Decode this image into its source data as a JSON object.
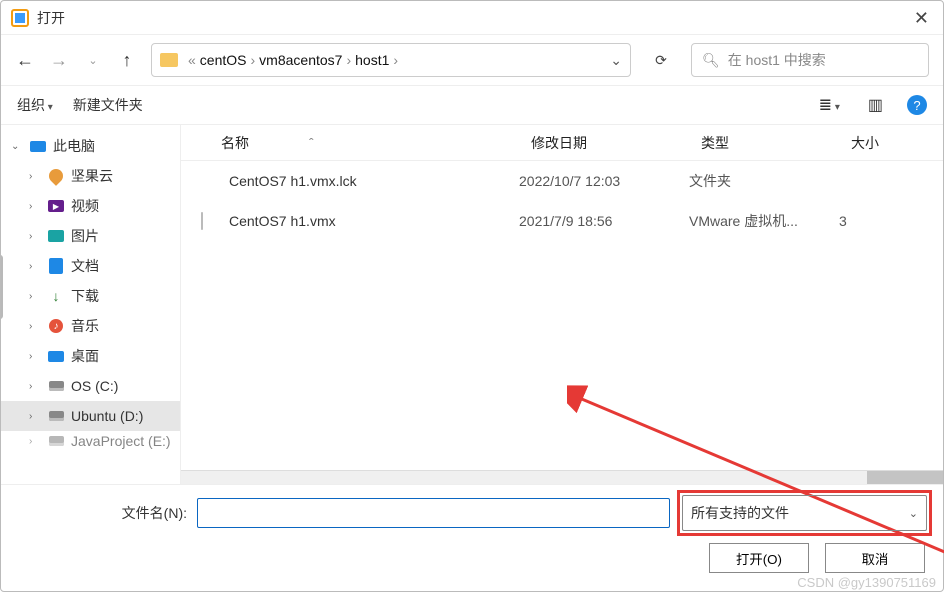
{
  "window": {
    "title": "打开"
  },
  "breadcrumb": {
    "prefix": "«",
    "parts": [
      "centOS",
      "vm8acentos7",
      "host1"
    ]
  },
  "search": {
    "placeholder": "在 host1 中搜索"
  },
  "toolbar": {
    "organize": "组织",
    "newfolder": "新建文件夹"
  },
  "sidebar": {
    "root": "此电脑",
    "items": [
      {
        "label": "坚果云"
      },
      {
        "label": "视频"
      },
      {
        "label": "图片"
      },
      {
        "label": "文档"
      },
      {
        "label": "下载"
      },
      {
        "label": "音乐"
      },
      {
        "label": "桌面"
      },
      {
        "label": "OS (C:)"
      },
      {
        "label": "Ubuntu (D:)"
      },
      {
        "label": "JavaProject (E:)"
      }
    ]
  },
  "columns": {
    "name": "名称",
    "date": "修改日期",
    "type": "类型",
    "size": "大小",
    "sort_indicator": "ˆ"
  },
  "rows": [
    {
      "name": "CentOS7 h1.vmx.lck",
      "date": "2022/10/7 12:03",
      "type": "文件夹",
      "size": "",
      "kind": "folder"
    },
    {
      "name": "CentOS7 h1.vmx",
      "date": "2021/7/9 18:56",
      "type": "VMware 虚拟机...",
      "size": "3",
      "kind": "vmx"
    }
  ],
  "footer": {
    "fn_label": "文件名(N):",
    "fn_value": "",
    "filter": "所有支持的文件",
    "open": "打开(O)",
    "cancel": "取消"
  },
  "watermark": "CSDN @gy1390751169"
}
